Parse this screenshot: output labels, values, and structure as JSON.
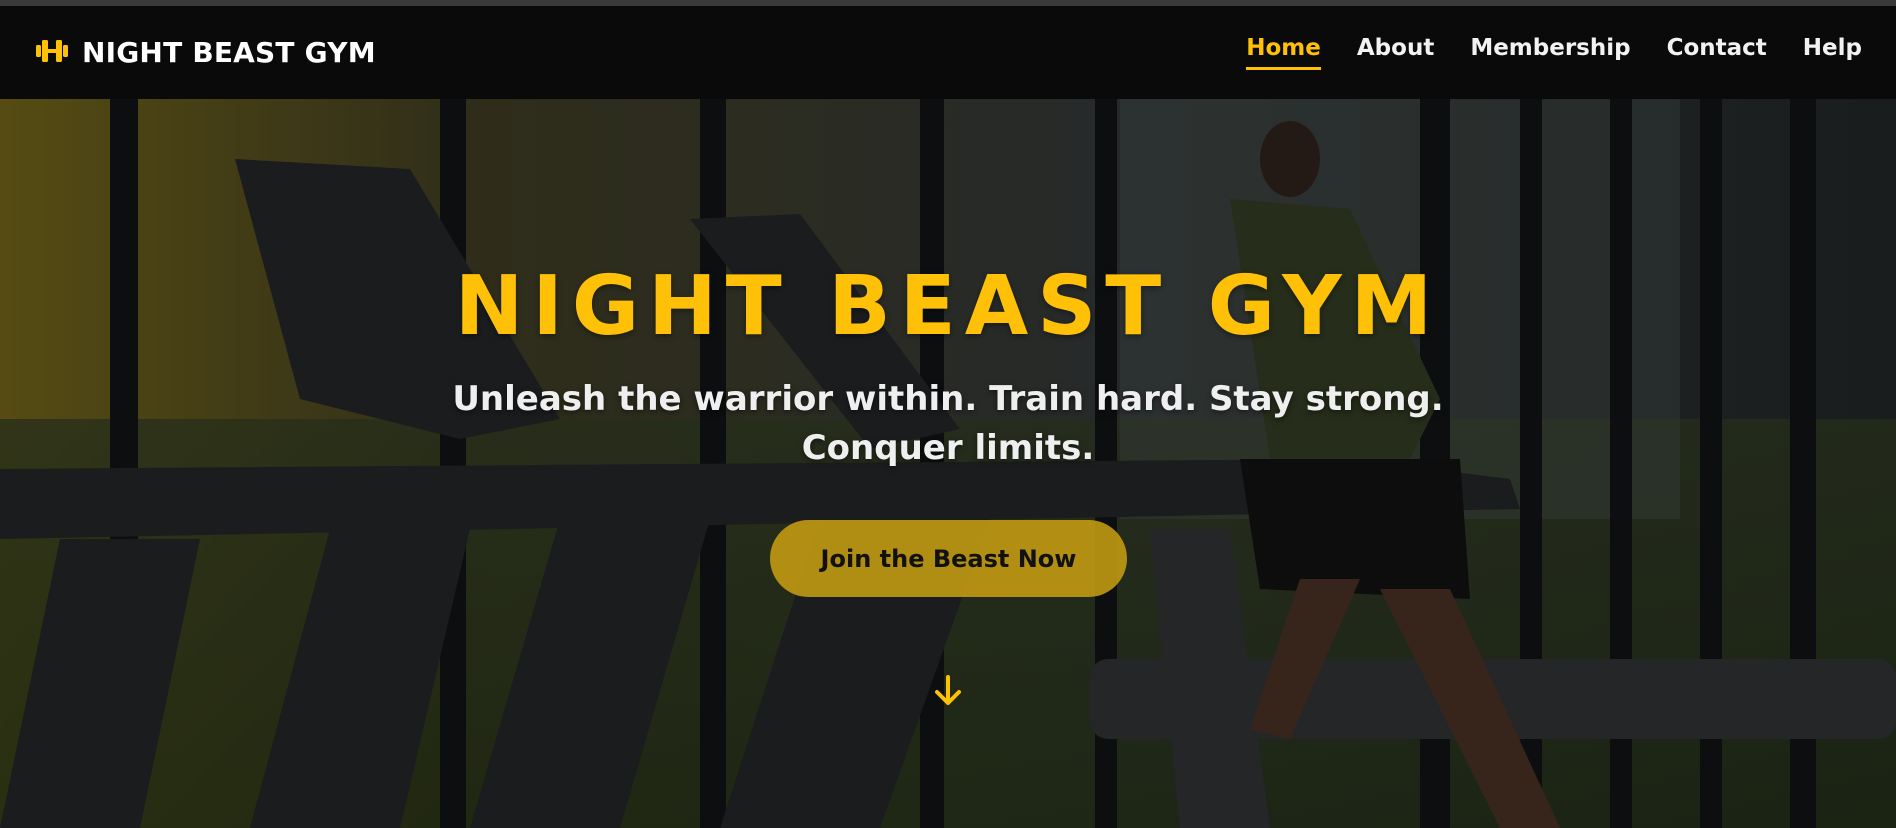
{
  "brand": {
    "name": "NIGHT BEAST GYM",
    "icon": "dumbbell-icon"
  },
  "nav": {
    "items": [
      {
        "label": "Home",
        "active": true
      },
      {
        "label": "About",
        "active": false
      },
      {
        "label": "Membership",
        "active": false
      },
      {
        "label": "Contact",
        "active": false
      },
      {
        "label": "Help",
        "active": false
      }
    ]
  },
  "hero": {
    "title": "NIGHT BEAST GYM",
    "subtitle": "Unleash the warrior within. Train hard. Stay strong. Conquer limits.",
    "cta_label": "Join the Beast Now",
    "scroll_icon": "arrow-down-icon",
    "background_image": "gym-treadmills-runner-photo"
  },
  "colors": {
    "accent": "#ffc107",
    "navbar_bg": "#0a0a0a",
    "text_light": "#f2f2f2",
    "cta_bg": "#caa012"
  }
}
